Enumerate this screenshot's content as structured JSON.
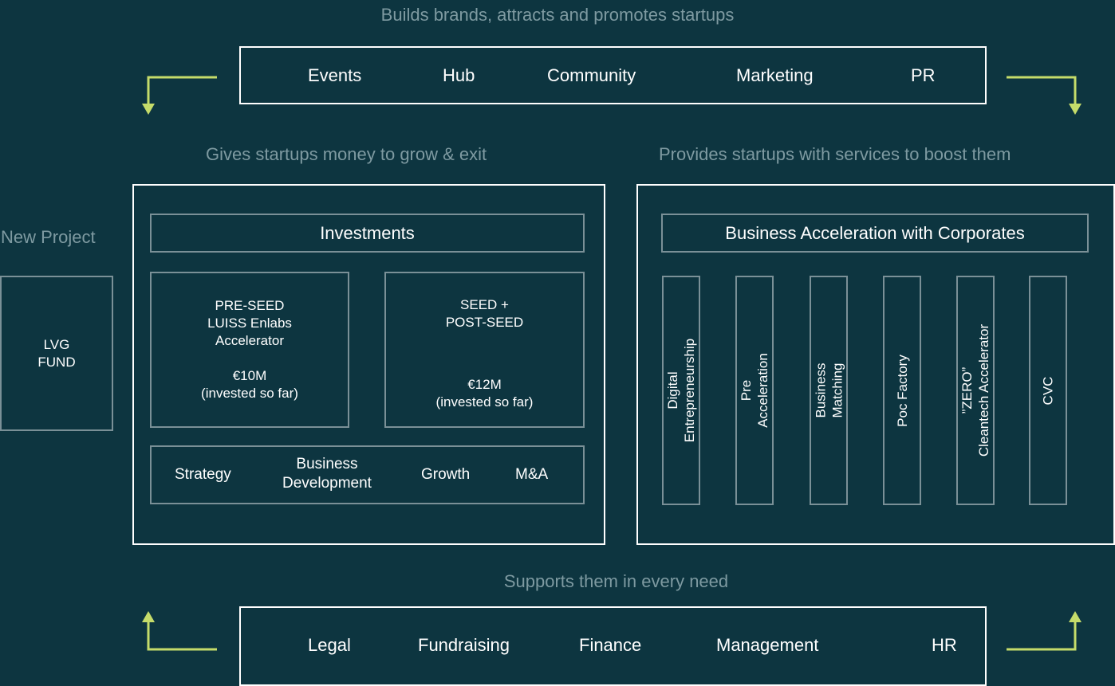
{
  "top": {
    "caption": "Builds brands, attracts and promotes startups",
    "items": [
      "Events",
      "Hub",
      "Community",
      "Marketing",
      "PR"
    ]
  },
  "left_caption": "Gives startups money to grow & exit",
  "right_caption": "Provides startups with services to boost them",
  "new_project": {
    "caption": "New Project",
    "box_line1": "LVG",
    "box_line2": "FUND"
  },
  "investments": {
    "title": "Investments",
    "pre_seed": {
      "line1": "PRE-SEED",
      "line2": "LUISS Enlabs",
      "line3": "Accelerator",
      "amount": "€10M",
      "note": "(invested so far)"
    },
    "seed": {
      "line1": "SEED +",
      "line2": "POST-SEED",
      "amount": "€12M",
      "note": "(invested so far)"
    },
    "services": {
      "strategy": "Strategy",
      "bizdev_line1": "Business",
      "bizdev_line2": "Development",
      "growth": "Growth",
      "ma": "M&A"
    }
  },
  "acceleration": {
    "title": "Business Acceleration with Corporates",
    "columns": [
      {
        "line1": "Digital",
        "line2": "Entrepreneurship"
      },
      {
        "line1": "Pre",
        "line2": "Acceleration"
      },
      {
        "line1": "Business",
        "line2": "Matching"
      },
      {
        "line1": "Poc Factory",
        "line2": ""
      },
      {
        "line1": "”ZERO”",
        "line2": "Cleantech Accelerator"
      },
      {
        "line1": "CVC",
        "line2": ""
      }
    ]
  },
  "bottom": {
    "caption": "Supports them in every need",
    "items": [
      "Legal",
      "Fundraising",
      "Finance",
      "Management",
      "HR"
    ]
  },
  "colors": {
    "background": "#0d3540",
    "accent_arrow": "#c5dc6a",
    "caption": "#7e9aa1",
    "box_border_gray": "#7a9097",
    "box_border_white": "#ffffff"
  },
  "icons": {
    "top_left": "arrow-left-down-icon",
    "top_right": "arrow-right-down-icon",
    "bottom_left": "arrow-up-left-icon",
    "bottom_right": "arrow-up-right-icon"
  }
}
